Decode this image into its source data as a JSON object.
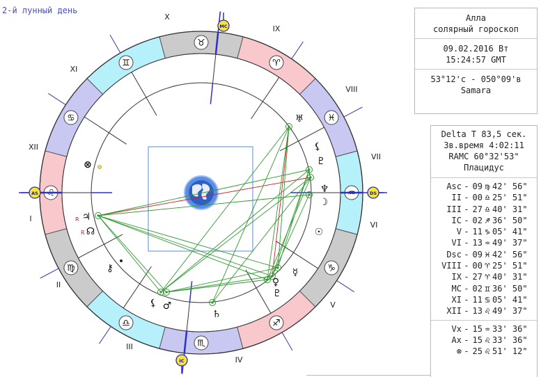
{
  "lunar_day": "2-й лунный день",
  "info": {
    "name": "Алла",
    "type": "солярный гороскоп",
    "date": "09.02.2016 Вт",
    "time": "15:24:57 GMT",
    "coords": "53°12'с - 050°09'в",
    "place": "Samara"
  },
  "params": {
    "delta_t": "Delta T  83,5 сек.",
    "star_time": "Зв.время 4:02:11",
    "ramc": "RAMC 60°32'53\"",
    "system": "Плацидус"
  },
  "cusps": [
    {
      "name": "Asc",
      "deg": "09",
      "sign": "♍",
      "min": "42' 56\""
    },
    {
      "name": "II",
      "deg": "00",
      "sign": "♎",
      "min": "25' 51\""
    },
    {
      "name": "III",
      "deg": "27",
      "sign": "♎",
      "min": "40' 31\""
    },
    {
      "name": "IC",
      "deg": "02",
      "sign": "♐",
      "min": "36' 50\""
    },
    {
      "name": "V",
      "deg": "11",
      "sign": "♑",
      "min": "05' 41\""
    },
    {
      "name": "VI",
      "deg": "13",
      "sign": "♒",
      "min": "49' 37\""
    },
    {
      "name": "Dsc",
      "deg": "09",
      "sign": "♓",
      "min": "42' 56\""
    },
    {
      "name": "VIII",
      "deg": "00",
      "sign": "♈",
      "min": "25' 51\""
    },
    {
      "name": "IX",
      "deg": "27",
      "sign": "♈",
      "min": "40' 31\""
    },
    {
      "name": "MC",
      "deg": "02",
      "sign": "♊",
      "min": "36' 50\""
    },
    {
      "name": "XI",
      "deg": "11",
      "sign": "♋",
      "min": "05' 41\""
    },
    {
      "name": "XII",
      "deg": "13",
      "sign": "♌",
      "min": "49' 37\""
    }
  ],
  "points": [
    {
      "name": "Vx",
      "deg": "15",
      "sign": "♒",
      "min": "33' 36\""
    },
    {
      "name": "Ax",
      "deg": "15",
      "sign": "♌",
      "min": "33' 36\""
    },
    {
      "name": "⊗",
      "deg": "25",
      "sign": "♌",
      "min": "51' 12\""
    }
  ],
  "wheel": {
    "house_labels": [
      "I",
      "II",
      "III",
      "IV",
      "V",
      "VI",
      "VII",
      "VIII",
      "IX",
      "X",
      "XI",
      "XII"
    ],
    "axis_labels": {
      "asc": "AS",
      "dsc": "DS",
      "mc": "MC",
      "ic": "IC"
    },
    "signs": [
      "♈",
      "♉",
      "♊",
      "♋",
      "♌",
      "♍",
      "♎",
      "♏",
      "♐",
      "♑",
      "♒",
      "♓"
    ],
    "planets": {
      "jupiter": "♃",
      "node": "☊",
      "mars": "♂",
      "chiron": "⚷",
      "moon": "☽",
      "sun": "☉",
      "mercury": "☿",
      "venus": "♀",
      "pluto": "♇",
      "neptune": "♆",
      "uranus": "♅",
      "saturn": "♄",
      "lilith": "⚸",
      "fortune": "⊗",
      "retro": "R"
    },
    "colors": {
      "ring_blue": "#b6f0fb",
      "ring_purple": "#c8c8f2",
      "ring_pink": "#f8c8cc",
      "ring_gray": "#cbcbcb",
      "green": "#2f9a2f",
      "red": "#cc2020",
      "axis": "#3030c0",
      "marker": "#f5e43a"
    }
  }
}
